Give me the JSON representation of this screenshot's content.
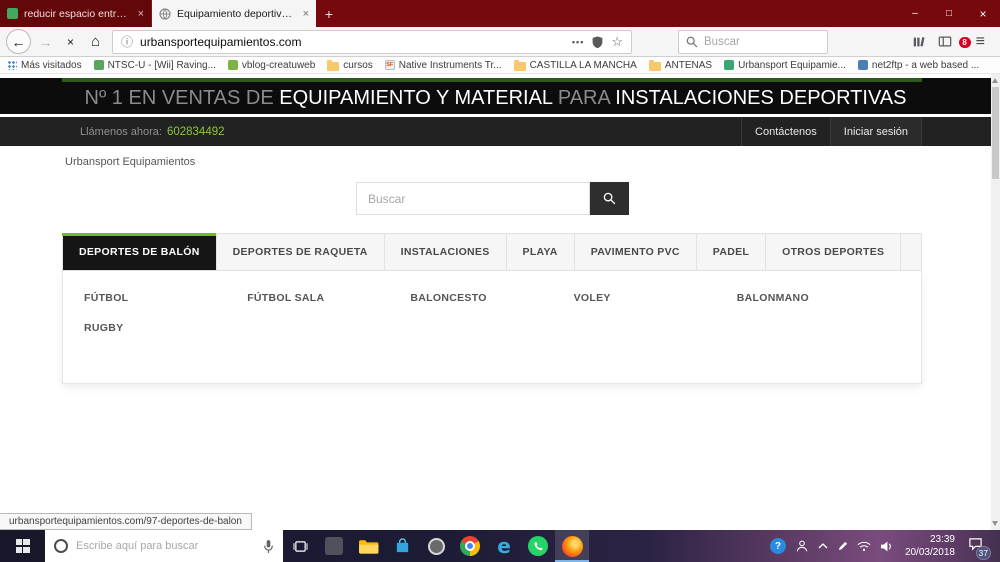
{
  "colors": {
    "titlebar_red": "#75090d",
    "accent_green": "#76b82a",
    "phone_green": "#8dc63f",
    "banner_bg": "#0c0c0c",
    "banner_strip_green": "#2d5a1d",
    "topbar_bg": "#222222",
    "badge_red": "#d70022",
    "taskbar_navy": "#17172a",
    "taskbar_purple": "#7a4c7d"
  },
  "browser": {
    "tabs": [
      {
        "title": "reducir espacio entre titulos de"
      },
      {
        "title": "Equipamiento deportivo para e"
      }
    ],
    "window": {
      "minimize": "–",
      "maximize": "□",
      "close": "×"
    },
    "new_tab": "+",
    "nav": {
      "back": "←",
      "forward": "→",
      "stop": "×",
      "home": "⌂",
      "info": "ⓘ",
      "dots": "•••",
      "star": "☆",
      "menu": "≡"
    },
    "url": "urbansportequipamientos.com",
    "search_placeholder": "Buscar",
    "extension_badge": "8",
    "bookmarks": [
      {
        "label": "Más visitados"
      },
      {
        "label": "NTSC-U - [Wii] Raving..."
      },
      {
        "label": "vblog-creatuweb"
      },
      {
        "label": "cursos"
      },
      {
        "label": "Native Instruments Tr...",
        "icon_text": "SF"
      },
      {
        "label": "CASTILLA LA MANCHA"
      },
      {
        "label": "ANTENAS"
      },
      {
        "label": "Urbansport Equipamie..."
      },
      {
        "label": "net2ftp - a web based ..."
      }
    ],
    "status_url": "urbansportequipamientos.com/97-deportes-de-balon"
  },
  "page": {
    "banner": {
      "muted1": "Nº 1 EN VENTAS DE ",
      "strong1": "EQUIPAMIENTO Y MATERIAL ",
      "muted2": "PARA ",
      "strong2": "INSTALACIONES DEPORTIVAS"
    },
    "topbar": {
      "call_label": "Llámenos ahora:",
      "phone": "602834492",
      "contact": "Contáctenos",
      "login": "Iniciar sesión"
    },
    "logo": "Urbansport Equipamientos",
    "search_placeholder": "Buscar",
    "menu": [
      {
        "label": "DEPORTES DE BALÓN"
      },
      {
        "label": "DEPORTES DE RAQUETA"
      },
      {
        "label": "INSTALACIONES"
      },
      {
        "label": "PLAYA"
      },
      {
        "label": "PAVIMENTO PVC"
      },
      {
        "label": "PADEL"
      },
      {
        "label": "OTROS DEPORTES"
      }
    ],
    "dropdown": [
      {
        "label": "FÚTBOL"
      },
      {
        "label": "FÚTBOL SALA"
      },
      {
        "label": "BALONCESTO"
      },
      {
        "label": "VOLEY"
      },
      {
        "label": "BALONMANO"
      },
      {
        "label": "RUGBY"
      }
    ]
  },
  "taskbar": {
    "search_placeholder": "Escribe aquí para buscar",
    "edge_letter": "e",
    "help_mark": "?",
    "time": "23:39",
    "date": "20/03/2018",
    "notification_count": "37"
  }
}
